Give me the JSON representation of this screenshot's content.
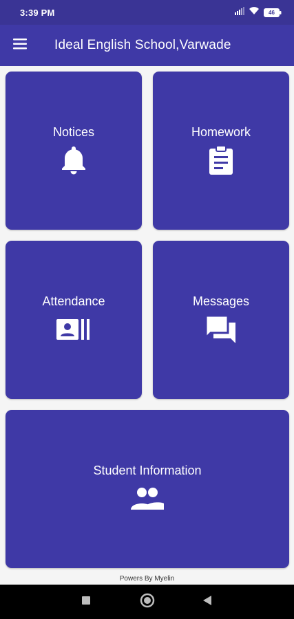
{
  "status_bar": {
    "time": "3:39 PM",
    "battery_level": "46",
    "icons": [
      "signal-icon",
      "wifi-icon",
      "battery-icon"
    ]
  },
  "app_bar": {
    "title": "Ideal English School,Varwade",
    "menu_icon": "menu-icon"
  },
  "tiles": [
    {
      "label": "Notices",
      "icon": "bell-icon"
    },
    {
      "label": "Homework",
      "icon": "clipboard-icon"
    },
    {
      "label": "Attendance",
      "icon": "attendance-card-icon"
    },
    {
      "label": "Messages",
      "icon": "chat-icon"
    },
    {
      "label": "Student Information",
      "icon": "people-icon"
    }
  ],
  "footer": {
    "text": "Powers By Myelin"
  },
  "nav_bar": {
    "buttons": [
      "recents-square-icon",
      "home-circle-icon",
      "back-triangle-icon"
    ]
  },
  "colors": {
    "status_bar": "#3a3495",
    "app_bar": "#3f39a6",
    "tile": "#3f39a6",
    "background": "#f5f5f5",
    "nav_bar": "#000000"
  }
}
